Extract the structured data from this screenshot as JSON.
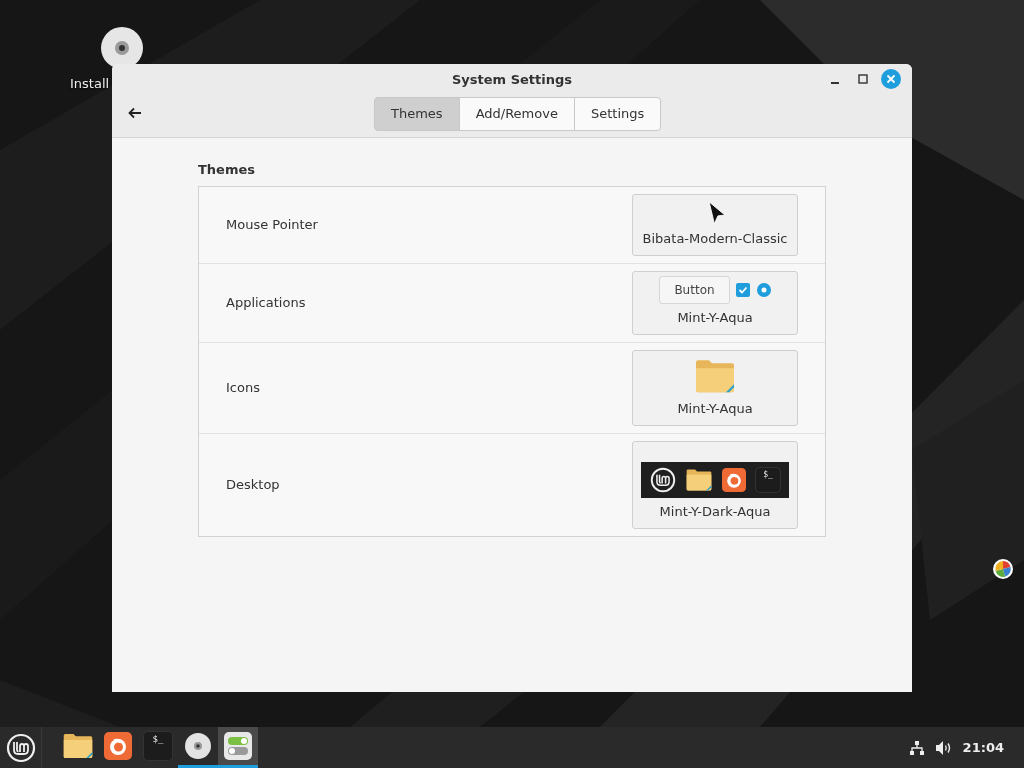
{
  "desktop": {
    "icons": [
      {
        "label": "Install"
      }
    ]
  },
  "window": {
    "title": "System Settings",
    "tabs": [
      {
        "label": "Themes",
        "selected": true
      },
      {
        "label": "Add/Remove",
        "selected": false
      },
      {
        "label": "Settings",
        "selected": false
      }
    ],
    "section_title": "Themes",
    "rows": [
      {
        "label": "Mouse Pointer",
        "kind": "pointer",
        "value": "Bibata-Modern-Classic"
      },
      {
        "label": "Applications",
        "kind": "widgets",
        "value": "Mint-Y-Aqua",
        "sample_button": "Button"
      },
      {
        "label": "Icons",
        "kind": "folder",
        "value": "Mint-Y-Aqua"
      },
      {
        "label": "Desktop",
        "kind": "panel",
        "value": "Mint-Y-Dark-Aqua",
        "terminal_glyph": "$_"
      }
    ]
  },
  "taskbar": {
    "launchers": [
      {
        "kind": "files",
        "running": false,
        "selected": false
      },
      {
        "kind": "browser",
        "running": false,
        "selected": false
      },
      {
        "kind": "terminal",
        "running": false,
        "selected": false,
        "glyph": "$_"
      },
      {
        "kind": "disc",
        "running": true,
        "selected": false
      },
      {
        "kind": "settings",
        "running": true,
        "selected": true
      }
    ],
    "clock": "21:04"
  }
}
